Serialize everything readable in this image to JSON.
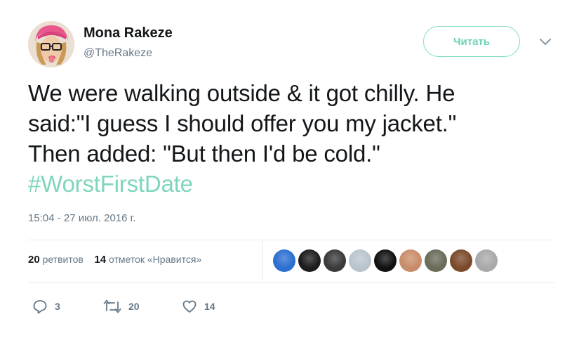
{
  "user": {
    "name": "Mona Rakeze",
    "handle": "@TheRakeze"
  },
  "follow_button_label": "Читать",
  "tweet": {
    "lines": [
      "We were walking outside & it got chilly. He",
      "said:\"I guess I should offer you my jacket.\"",
      "Then added: \"But then I'd be cold.\""
    ],
    "hashtag": "#WorstFirstDate",
    "timestamp": "15:04 - 27 июл. 2016 г."
  },
  "stats": {
    "retweets_count": "20",
    "retweets_label": "ретвитов",
    "likes_count": "14",
    "likes_label": "отметок «Нравится»"
  },
  "liker_avatars": [
    {
      "name": "liker-avatar-1",
      "color": "#2c6fd1"
    },
    {
      "name": "liker-avatar-2",
      "color": "#1c1c1c"
    },
    {
      "name": "liker-avatar-3",
      "color": "#3a3a3a"
    },
    {
      "name": "liker-avatar-4",
      "color": "#b9c4cc"
    },
    {
      "name": "liker-avatar-5",
      "color": "#111111"
    },
    {
      "name": "liker-avatar-6",
      "color": "#c98c6a"
    },
    {
      "name": "liker-avatar-7",
      "color": "#6b6b5a"
    },
    {
      "name": "liker-avatar-8",
      "color": "#7a4a2a"
    },
    {
      "name": "liker-avatar-9",
      "color": "#a9a9a9"
    }
  ],
  "actions": {
    "reply_count": "3",
    "retweet_count": "20",
    "like_count": "14"
  },
  "colors": {
    "accent": "#7ed6bd",
    "secondary_text": "#657786",
    "primary_text": "#14171a",
    "divider": "#e6ecf0"
  },
  "icons": [
    "reply-icon",
    "retweet-icon",
    "heart-icon",
    "chevron-down-icon"
  ]
}
